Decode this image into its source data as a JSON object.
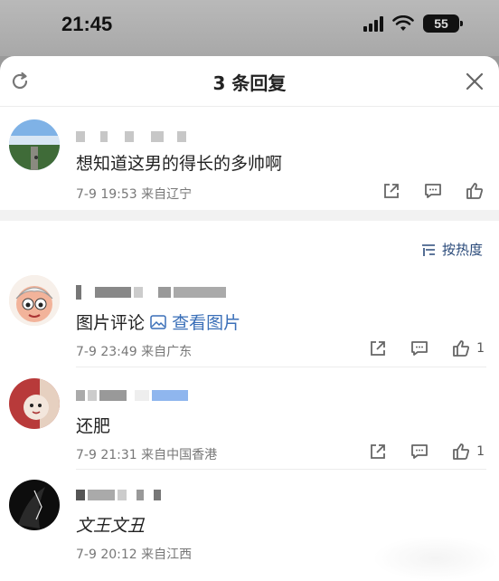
{
  "status": {
    "time": "21:45",
    "battery": "55"
  },
  "header": {
    "title": "3 条回复"
  },
  "root_comment": {
    "text": "想知道这男的得长的多帅啊",
    "meta": "7-9 19:53 来自辽宁"
  },
  "sort": {
    "label": "按热度"
  },
  "replies": [
    {
      "text": "图片评论",
      "link": "查看图片",
      "meta": "7-9 23:49 来自广东",
      "likes": "1"
    },
    {
      "text": "还肥",
      "meta": "7-9 21:31 来自中国香港",
      "likes": "1"
    },
    {
      "text": "文王文丑",
      "meta": "7-9 20:12 来自江西"
    }
  ],
  "colors": {
    "accent": "#3a6fb8",
    "sort": "#2a4a7a"
  }
}
